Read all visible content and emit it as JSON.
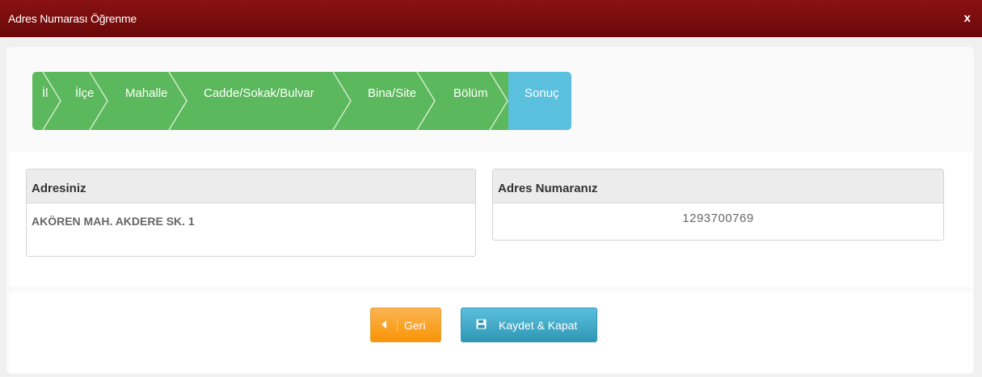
{
  "window": {
    "title": "Adres Numarası Öğrenme",
    "close_label": "x"
  },
  "steps": [
    {
      "label": "İl",
      "state": "done"
    },
    {
      "label": "İlçe",
      "state": "done"
    },
    {
      "label": "Mahalle",
      "state": "done"
    },
    {
      "label": "Cadde/Sokak/Bulvar",
      "state": "done"
    },
    {
      "label": "Bina/Site",
      "state": "done"
    },
    {
      "label": "Bölüm",
      "state": "done"
    },
    {
      "label": "Sonuç",
      "state": "active"
    }
  ],
  "address_panel": {
    "header": "Adresiniz",
    "value": "AKÖREN MAH. AKDERE SK. 1"
  },
  "number_panel": {
    "header": "Adres Numaranız",
    "value": "1293700769"
  },
  "buttons": {
    "back_label": "Geri",
    "back_icon": "caret-left-icon",
    "save_label": "Kaydet & Kapat",
    "save_icon": "floppy-disk-icon"
  },
  "colors": {
    "titlebar": "#7a0e0e",
    "step_done": "#5cb85c",
    "step_active": "#5bc0de",
    "back_button": "#f89406",
    "save_button": "#2f96b4"
  }
}
